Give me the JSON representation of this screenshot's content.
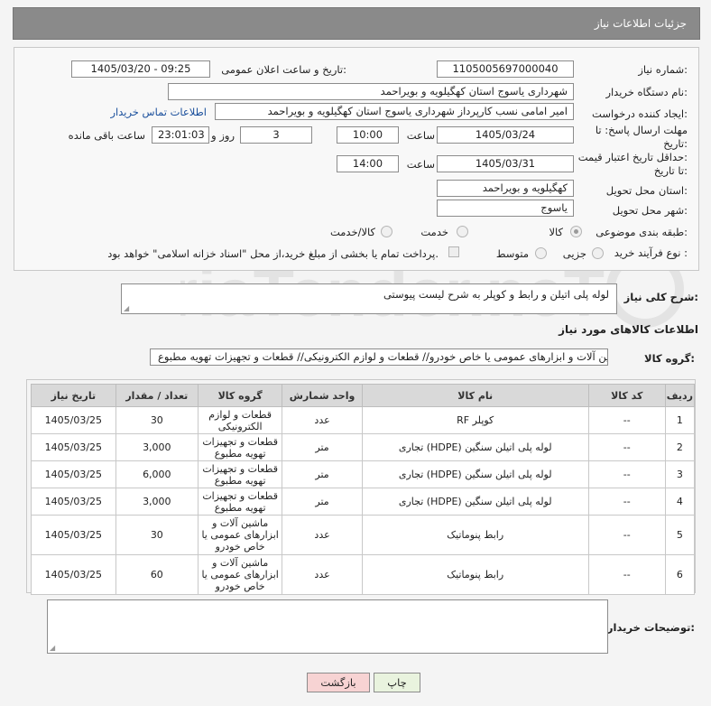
{
  "header": {
    "title": "جزئیات اطلاعات نیاز"
  },
  "form": {
    "need_number_label": "شماره نیاز:",
    "need_number": "1105005697000040",
    "announce_label": "تاریخ و ساعت اعلان عمومی:",
    "announce_value": "1405/03/20 - 09:25",
    "buyer_org_label": "نام دستگاه خریدار:",
    "buyer_org": "شهرداری یاسوج استان کهگیلویه و بویراحمد",
    "creator_label": "ایجاد کننده درخواست:",
    "creator": "امیر امامی نسب کارپرداز شهرداری یاسوج استان کهگیلویه و بویراحمد",
    "contact_link": "اطلاعات تماس خریدار",
    "deadline_label_1": "مهلت ارسال پاسخ: تا",
    "deadline_label_2": "تاریخ:",
    "deadline_date": "1405/03/24",
    "time_label": "ساعت",
    "deadline_time": "10:00",
    "days_value": "3",
    "days_label": "روز و",
    "remaining_value": "23:01:03",
    "remaining_label": "ساعت باقی مانده",
    "price_validity_label_1": "حداقل تاریخ اعتبار قیمت:",
    "price_validity_label_2": "تا تاریخ:",
    "price_validity_date": "1405/03/31",
    "price_validity_time": "14:00",
    "province_label": "استان محل تحویل:",
    "province": "کهگیلویه و بویراحمد",
    "city_label": "شهر محل تحویل:",
    "city": "یاسوج",
    "category_label": "طبقه بندی موضوعی:",
    "category_options": [
      "کالا",
      "خدمت",
      "کالا/خدمت"
    ],
    "category_selected": "کالا",
    "process_label": "نوع فرآیند خرید :",
    "process_options": [
      "جزیی",
      "متوسط"
    ],
    "payment_note": "پرداخت تمام یا بخشی از مبلغ خرید،از محل \"اسناد خزانه اسلامی\" خواهد بود."
  },
  "description": {
    "label": "شرح کلی نیاز:",
    "value": "لوله پلی اتیلن و رابط و کوپلر به شرح لیست پیوستی"
  },
  "goods": {
    "section_title": "اطلاعات کالاهای مورد نیاز",
    "group_label": "گروه کالا:",
    "group_value": "ماشین آلات و ابزارهای عمومی یا خاص خودرو// قطعات و لوازم الکترونیکی//  قطعات و تجهیزات تهویه مطبوع",
    "columns": [
      "ردیف",
      "کد کالا",
      "نام کالا",
      "واحد شمارش",
      "گروه کالا",
      "تعداد / مقدار",
      "تاریخ نیاز"
    ],
    "rows": [
      {
        "row": "1",
        "code": "--",
        "name": "کوپلر RF",
        "unit": "عدد",
        "group": "قطعات و لوازم الکترونیکی",
        "qty": "30",
        "date": "1405/03/25"
      },
      {
        "row": "2",
        "code": "--",
        "name": "لوله پلی اتیلن سنگین (HDPE) تجاری",
        "unit": "متر",
        "group": "قطعات و تجهیزات تهویه مطبوع",
        "qty": "3,000",
        "date": "1405/03/25"
      },
      {
        "row": "3",
        "code": "--",
        "name": "لوله پلی اتیلن سنگین (HDPE) تجاری",
        "unit": "متر",
        "group": "قطعات و تجهیزات تهویه مطبوع",
        "qty": "6,000",
        "date": "1405/03/25"
      },
      {
        "row": "4",
        "code": "--",
        "name": "لوله پلی اتیلن سنگین (HDPE) تجاری",
        "unit": "متر",
        "group": "قطعات و تجهیزات تهویه مطبوع",
        "qty": "3,000",
        "date": "1405/03/25"
      },
      {
        "row": "5",
        "code": "--",
        "name": "رابط پنوماتیک",
        "unit": "عدد",
        "group": "ماشین آلات و ابزارهای عمومی یا خاص خودرو",
        "qty": "30",
        "date": "1405/03/25"
      },
      {
        "row": "6",
        "code": "--",
        "name": "رابط پنوماتیک",
        "unit": "عدد",
        "group": "ماشین آلات و ابزارهای عمومی یا خاص خودرو",
        "qty": "60",
        "date": "1405/03/25"
      }
    ]
  },
  "buyer_notes": {
    "label": "توضیحات خریدار:",
    "value": ""
  },
  "buttons": {
    "print": "چاپ",
    "back": "بازگشت"
  },
  "watermark": {
    "text": "AriaTender.neT"
  }
}
